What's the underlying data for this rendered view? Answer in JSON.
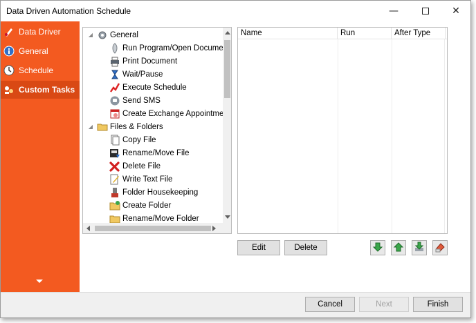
{
  "window": {
    "title": "Data Driven Automation Schedule"
  },
  "sidebar": {
    "items": [
      {
        "label": "Data Driver",
        "icon": "data-driver-icon"
      },
      {
        "label": "General",
        "icon": "info-icon"
      },
      {
        "label": "Schedule",
        "icon": "clock-icon"
      },
      {
        "label": "Custom Tasks",
        "icon": "tasks-icon",
        "active": true
      }
    ],
    "accent": "#f35a20"
  },
  "tree": {
    "items": [
      {
        "label": "General",
        "icon": "gear-icon",
        "expander": "◢"
      },
      {
        "label": "Run Program/Open Document",
        "icon": "run-program-icon"
      },
      {
        "label": "Print Document",
        "icon": "printer-icon"
      },
      {
        "label": "Wait/Pause",
        "icon": "hourglass-icon"
      },
      {
        "label": "Execute Schedule",
        "icon": "execute-schedule-icon"
      },
      {
        "label": "Send SMS",
        "icon": "sms-icon"
      },
      {
        "label": "Create Exchange Appointment",
        "icon": "calendar-icon"
      },
      {
        "label": "Files & Folders",
        "icon": "folder-icon",
        "expander": "◢"
      },
      {
        "label": "Copy File",
        "icon": "copy-file-icon"
      },
      {
        "label": "Rename/Move File",
        "icon": "rename-file-icon"
      },
      {
        "label": "Delete File",
        "icon": "delete-icon"
      },
      {
        "label": "Write Text File",
        "icon": "write-text-icon"
      },
      {
        "label": "Folder Housekeeping",
        "icon": "housekeeping-icon"
      },
      {
        "label": "Create Folder",
        "icon": "create-folder-icon"
      },
      {
        "label": "Rename/Move Folder",
        "icon": "rename-folder-icon"
      }
    ]
  },
  "grid": {
    "columns": [
      "Name",
      "Run",
      "After Type"
    ]
  },
  "actions": {
    "edit": "Edit",
    "delete": "Delete",
    "icons": [
      "move-down-icon",
      "move-up-icon",
      "import-icon",
      "clear-icon"
    ]
  },
  "footer": {
    "cancel": "Cancel",
    "next": "Next",
    "finish": "Finish"
  }
}
